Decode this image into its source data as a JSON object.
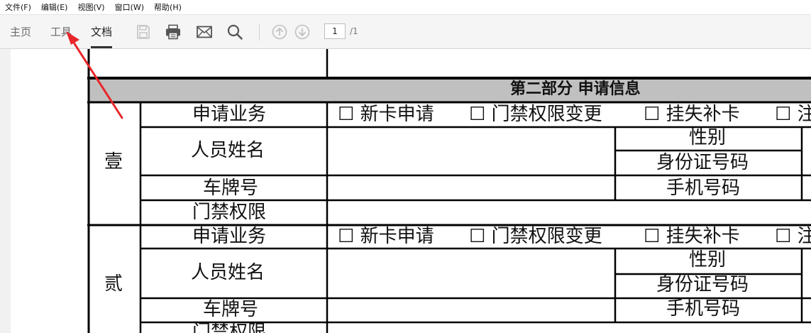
{
  "menu": [
    "文件(F)",
    "编辑(E)",
    "视图(V)",
    "窗口(W)",
    "帮助(H)"
  ],
  "tabs": {
    "home": "主页",
    "tools": "工具",
    "document": "文档"
  },
  "page": {
    "current": "1",
    "total": "/1"
  },
  "colors": {
    "annotation": "#e8262a",
    "header_band": "#c0c0c0"
  },
  "icons": [
    "save-icon",
    "print-icon",
    "mail-icon",
    "search-icon",
    "arrow-up-icon",
    "arrow-down-icon"
  ],
  "form": {
    "section_title": "第二部分 申请信息",
    "checkbox_symbol": "☐",
    "group1": {
      "label": "壹",
      "rows": {
        "business": "申请业务",
        "name": "人员姓名",
        "plate": "车牌号",
        "access": "门禁权限"
      },
      "options": [
        "新卡申请",
        "门禁权限变更",
        "挂失补卡",
        "注"
      ],
      "right_labels": {
        "gender": "性别",
        "id": "身份证号码",
        "phone": "手机号码"
      }
    },
    "group2": {
      "label": "贰",
      "rows": {
        "business": "申请业务",
        "name": "人员姓名",
        "plate": "车牌号",
        "access": "门禁权限"
      },
      "options": [
        "新卡申请",
        "门禁权限变更",
        "挂失补卡",
        "注"
      ],
      "right_labels": {
        "gender": "性别",
        "id": "身份证号码",
        "phone": "手机号码"
      }
    }
  }
}
